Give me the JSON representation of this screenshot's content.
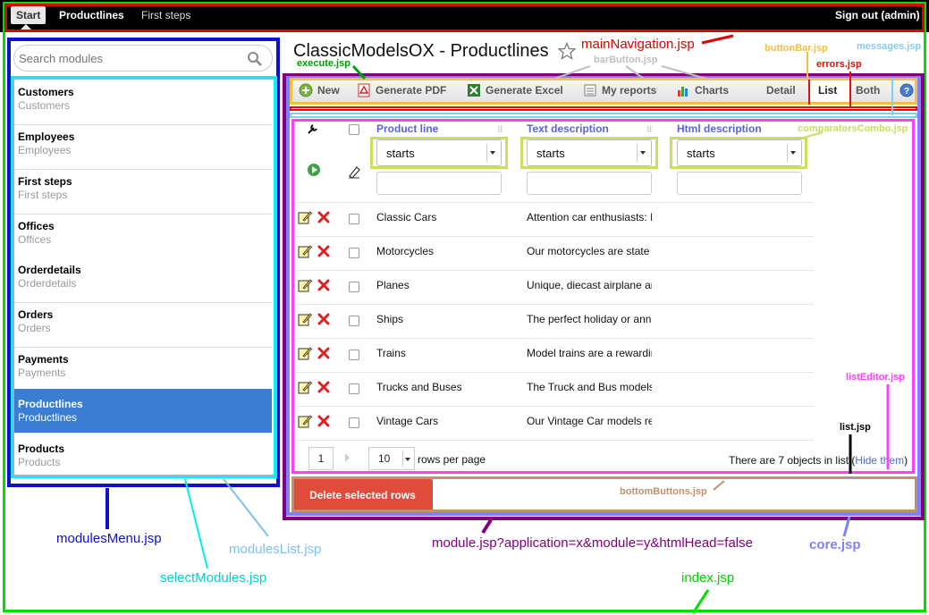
{
  "nav": {
    "start": "Start",
    "productlines": "Productlines",
    "first_steps": "First steps",
    "sign_out": "Sign out (admin)"
  },
  "sidebar": {
    "search_placeholder": "Search modules",
    "items": [
      {
        "title": "Customers",
        "subtitle": "Customers"
      },
      {
        "title": "Employees",
        "subtitle": "Employees"
      },
      {
        "title": "First steps",
        "subtitle": "First steps"
      },
      {
        "title": "Offices",
        "subtitle": "Offices"
      },
      {
        "title": "Orderdetails",
        "subtitle": "Orderdetails"
      },
      {
        "title": "Orders",
        "subtitle": "Orders"
      },
      {
        "title": "Payments",
        "subtitle": "Payments"
      },
      {
        "title": "Productlines",
        "subtitle": "Productlines",
        "selected": true
      },
      {
        "title": "Products",
        "subtitle": "Products"
      }
    ]
  },
  "title": "ClassicModelsOX - Productlines",
  "toolbar": {
    "new": "New",
    "pdf": "Generate PDF",
    "excel": "Generate Excel",
    "reports": "My reports",
    "charts": "Charts",
    "detail": "Detail",
    "list": "List",
    "both": "Both"
  },
  "table": {
    "columns": [
      "Product line",
      "Text description",
      "Html description"
    ],
    "comparator": "starts",
    "rows": [
      {
        "line": "Classic Cars",
        "text": "Attention car enthusiasts: M"
      },
      {
        "line": "Motorcycles",
        "text": "Our motorcycles are state of"
      },
      {
        "line": "Planes",
        "text": "Unique, diecast airplane and"
      },
      {
        "line": "Ships",
        "text": "The perfect holiday or annive"
      },
      {
        "line": "Trains",
        "text": "Model trains are a rewarding"
      },
      {
        "line": "Trucks and Buses",
        "text": "The Truck and Bus models a"
      },
      {
        "line": "Vintage Cars",
        "text": "Our Vintage Car models real"
      }
    ]
  },
  "pager": {
    "page": "1",
    "rows": "10",
    "rows_label": "rows per page",
    "count_text": "There are 7 objects in list (",
    "hide": "Hide them",
    "close_paren": ")"
  },
  "delete_button": "Delete selected rows",
  "annotations": {
    "mainNavigation": "mainNavigation.jsp",
    "execute": "execute.jsp",
    "barButton": "barButton.jsp",
    "buttonBar": "buttonBar.jsp",
    "errors": "errors.jsp",
    "messages": "messages.jsp",
    "comparatorsCombo": "comparatorsCombo.jsp",
    "listEditor": "listEditor.jsp",
    "list": "list.jsp",
    "bottomButtons": "bottomButtons.jsp",
    "modulesMenu": "modulesMenu.jsp",
    "modulesList": "modulesList.jsp",
    "selectModules": "selectModules.jsp",
    "module": "module.jsp?application=x&module=y&htmlHead=false",
    "core": "core.jsp",
    "index": "index.jsp"
  },
  "colors": {
    "index": "#00e000",
    "mainNavigation": "#e00000",
    "modulesMenu": "#1010d0",
    "selectModules": "#00f0f0",
    "modulesList": "#7ec0ee",
    "module": "#800080",
    "core": "#8080ff",
    "buttonBar": "#f0c040",
    "errors": "#e01010",
    "messages": "#88ccee",
    "comparatorsCombo": "#c8e060",
    "listEditor": "#ff40ff",
    "list": "#000000",
    "bottomButtons": "#c09070",
    "execute": "#00a000",
    "barButton": "#c0c0c0",
    "selected": "#3a7dd3",
    "danger": "#e04b3b"
  }
}
